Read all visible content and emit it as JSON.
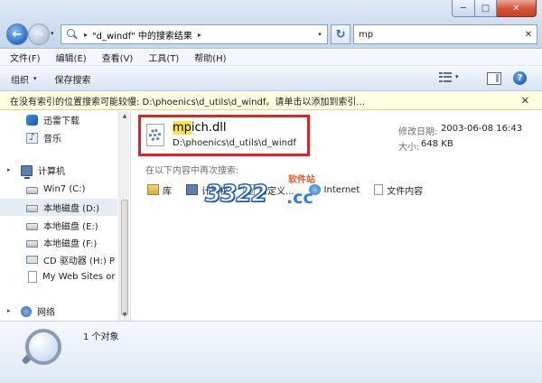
{
  "window": {
    "controls": {
      "minimize": "─",
      "maximize": "□",
      "close": "✕"
    }
  },
  "address_bar": {
    "location": "\"d_windf\" 中的搜索结果",
    "separator": "▸",
    "dropdown": "▾"
  },
  "nav_buttons": {
    "back": "←",
    "forward": "→",
    "history_dropdown": "▾"
  },
  "refresh": {
    "icon": "↻"
  },
  "search": {
    "value": "mp",
    "clear": "✕"
  },
  "menu": [
    "文件(F)",
    "编辑(E)",
    "查看(V)",
    "工具(T)",
    "帮助(H)"
  ],
  "command_bar": {
    "organize": "组织",
    "organize_arrow": "▾",
    "save_search": "保存搜索",
    "view_dropdown": "▾",
    "help": "?"
  },
  "info_bar": {
    "text": "在没有索引的位置搜索可能较慢: D:\\phoenics\\d_utils\\d_windf。请单击以添加到索引...",
    "close": "✕"
  },
  "nav_pane": {
    "items": [
      {
        "label": "迅雷下载",
        "icon": "thunder-icon"
      },
      {
        "label": "音乐",
        "icon": "music-icon"
      },
      {
        "label": "计算机",
        "icon": "computer-icon",
        "expand": "▸"
      },
      {
        "label": "Win7 (C:)",
        "icon": "drive-icon"
      },
      {
        "label": "本地磁盘 (D:)",
        "icon": "drive-icon",
        "selected": true
      },
      {
        "label": "本地磁盘 (E:)",
        "icon": "drive-icon"
      },
      {
        "label": "本地磁盘 (F:)",
        "icon": "drive-icon"
      },
      {
        "label": "CD 驱动器 (H:) P",
        "icon": "cd-drive-icon"
      },
      {
        "label": "My Web Sites or",
        "icon": "web-folder-icon"
      },
      {
        "label": "网络",
        "icon": "network-icon",
        "expand": "▸"
      }
    ],
    "scroll_up": "▲",
    "scroll_down": "▼"
  },
  "result": {
    "name_match": "mp",
    "name_rest": "ich.dll",
    "path": "D:\\phoenics\\d_utils\\d_windf",
    "modified_label": "修改日期:",
    "modified_value": "2003-06-08 16:43",
    "size_label": "大小:",
    "size_value": "648 KB"
  },
  "search_again": {
    "label": "在以下内容中再次搜索:",
    "locations": [
      {
        "label": "库",
        "icon": "library-icon"
      },
      {
        "label": "计算机",
        "icon": "computer-icon"
      },
      {
        "label": "自定义...",
        "icon": "custom-search-icon"
      },
      {
        "label": "Internet",
        "icon": "internet-icon"
      },
      {
        "label": "文件内容",
        "icon": "file-contents-icon"
      }
    ]
  },
  "watermark": {
    "number": "3322",
    "domain": ".cc",
    "tagline": "软件站"
  },
  "status": {
    "text": "1 个对象"
  },
  "colors": {
    "highlight_box": "#e02222",
    "match_highlight": "#ffe34d",
    "info_bar": "#ffffe1"
  }
}
